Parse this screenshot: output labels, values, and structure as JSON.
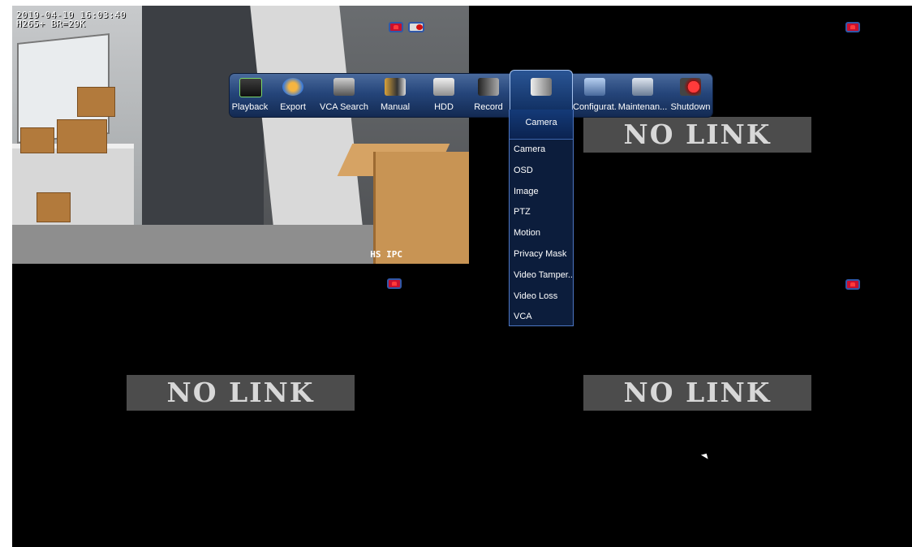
{
  "camera1": {
    "timestamp": "2019-04-10 16:03:40",
    "stream_info": "H265+ BR=29K",
    "brand_tag": "HS IPC"
  },
  "no_link_text": "NO LINK",
  "toolbar": {
    "items": [
      {
        "label": "Playback",
        "icon": "playback-icon"
      },
      {
        "label": "Export",
        "icon": "export-icon"
      },
      {
        "label": "VCA Search",
        "icon": "vca-search-icon"
      },
      {
        "label": "Manual",
        "icon": "manual-icon"
      },
      {
        "label": "HDD",
        "icon": "hdd-icon"
      },
      {
        "label": "Record",
        "icon": "record-icon"
      },
      {
        "label": "Camera",
        "icon": "camera-icon"
      },
      {
        "label": "Configurat...",
        "icon": "configuration-icon"
      },
      {
        "label": "Maintenan...",
        "icon": "maintenance-icon"
      },
      {
        "label": "Shutdown",
        "icon": "shutdown-icon"
      }
    ]
  },
  "camera_menu": {
    "title": "Camera",
    "items": [
      "Camera",
      "OSD",
      "Image",
      "PTZ",
      "Motion",
      "Privacy Mask",
      "Video Tamper...",
      "Video Loss",
      "VCA"
    ]
  },
  "colors": {
    "background": "#000000",
    "toolbar": "#25457a",
    "menu": "#0c1d3c",
    "menu_border": "#4d76c2",
    "no_link_bg": "#4c4c4c"
  }
}
